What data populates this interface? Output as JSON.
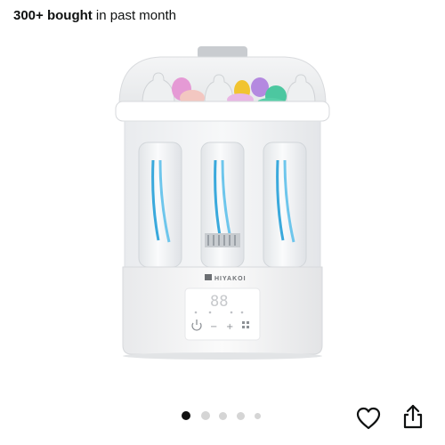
{
  "purchase_info": {
    "bought_bold": "300+ bought",
    "bought_rest": " in past month"
  },
  "product_image": {
    "brand_logo_text": "HIYAKOI",
    "display_readout": "88",
    "control_minus": "−",
    "control_plus": "+"
  },
  "carousel": {
    "total_images": 5,
    "active_index": 0
  },
  "actions": {
    "wishlist_icon": "heart-outline-icon",
    "share_icon": "share-icon"
  },
  "colors": {
    "active_dot": "#111111",
    "inactive_dot": "#d5d5d5",
    "text": "#0f1111"
  }
}
